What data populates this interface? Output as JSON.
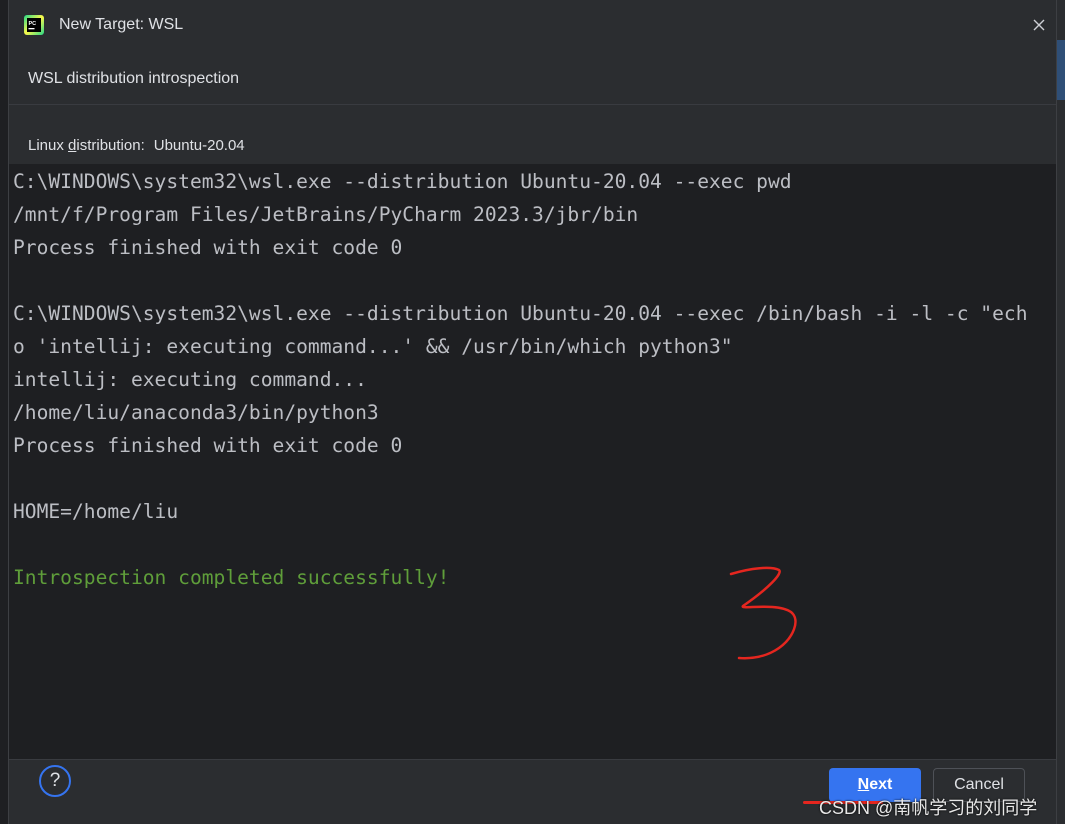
{
  "dialog": {
    "title": "New Target: WSL",
    "app_icon": "pycharm-icon",
    "close_icon": "close-icon"
  },
  "step": {
    "title": "WSL distribution introspection"
  },
  "distribution": {
    "label_prefix": "Linux ",
    "label_underlined": "d",
    "label_suffix": "istribution:",
    "value": "Ubuntu-20.04"
  },
  "console": {
    "lines": [
      "C:\\WINDOWS\\system32\\wsl.exe --distribution Ubuntu-20.04 --exec pwd",
      "/mnt/f/Program Files/JetBrains/PyCharm 2023.3/jbr/bin",
      "Process finished with exit code 0",
      "",
      "C:\\WINDOWS\\system32\\wsl.exe --distribution Ubuntu-20.04 --exec /bin/bash -i -l -c \"ech",
      "o 'intellij: executing command...' && /usr/bin/which python3\"",
      "intellij: executing command...",
      "/home/liu/anaconda3/bin/python3",
      "Process finished with exit code 0",
      "",
      "HOME=/home/liu",
      "",
      "Introspection completed successfully!"
    ],
    "success_color": "#5f9e3a",
    "text_color": "#bcbec4"
  },
  "footer": {
    "help_label": "?",
    "next_underlined": "N",
    "next_rest": "ext",
    "cancel_label": "Cancel",
    "accent_color": "#3574f0"
  },
  "watermark": "CSDN @南帆学习的刘同学"
}
